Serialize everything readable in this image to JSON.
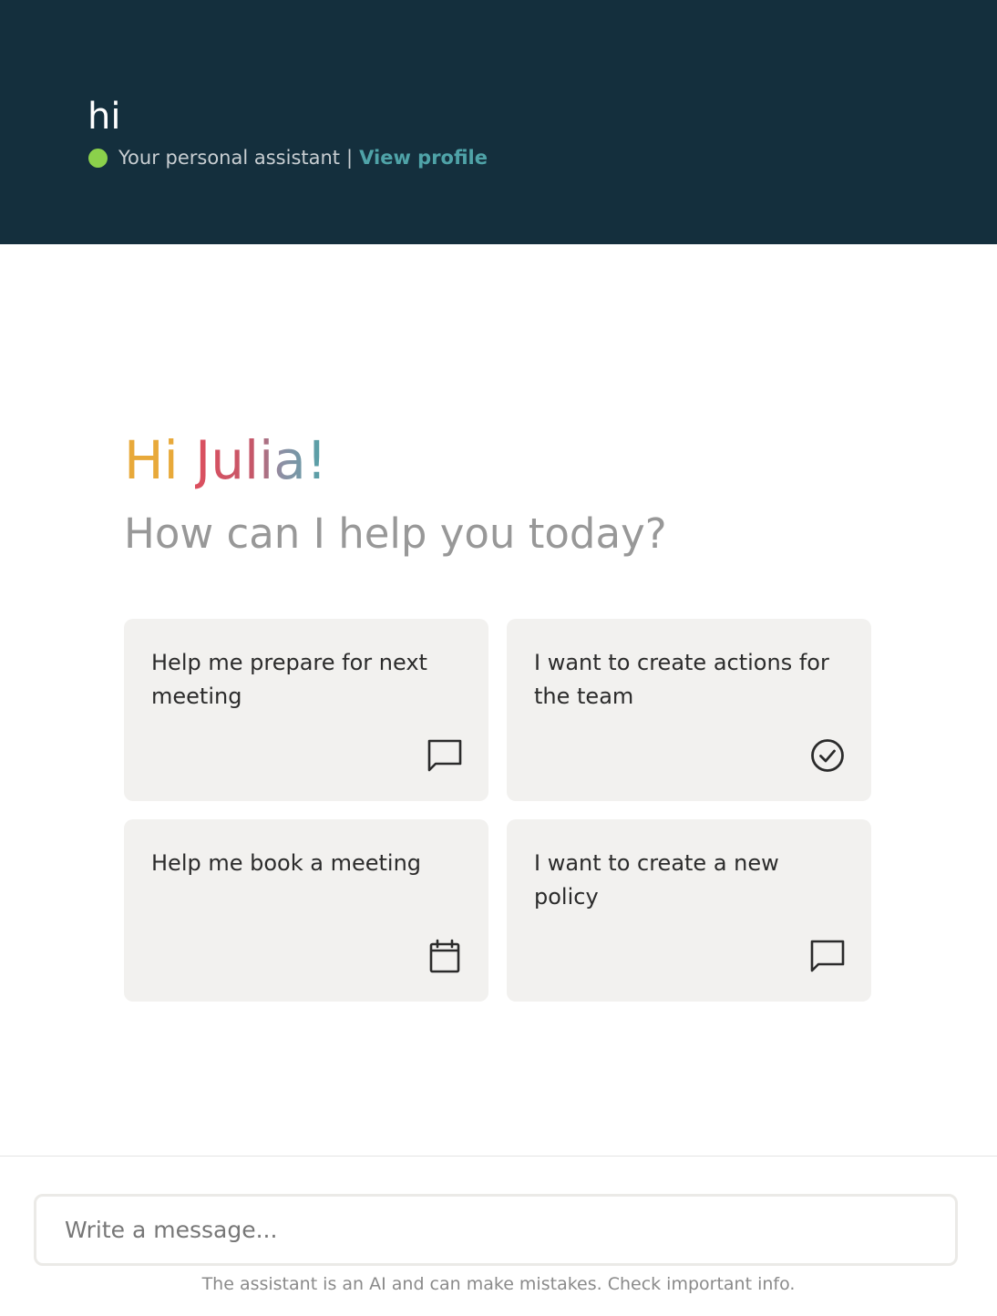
{
  "header": {
    "title": "hi",
    "status_text": "Your personal assistant",
    "separator": "|",
    "profile_link": "View profile",
    "status_color": "#8bd14b"
  },
  "greeting": {
    "hi": "Hi",
    "name": "Julia!",
    "subtitle": "How can I help you today?",
    "gradient_colors": [
      "#e8a93a",
      "#dc4f5e",
      "#c4586a",
      "#4fa3a8"
    ]
  },
  "suggestions": [
    {
      "text": "Help me prepare for next meeting",
      "icon": "chat-bubble-icon"
    },
    {
      "text": "I want to create actions for the team",
      "icon": "check-circle-icon"
    },
    {
      "text": "Help me book a meeting",
      "icon": "calendar-icon"
    },
    {
      "text": "I want to create a new policy",
      "icon": "chat-bubble-icon"
    }
  ],
  "composer": {
    "placeholder": "Write a message...",
    "disclaimer": "The assistant is an AI and can make mistakes. Check important info."
  }
}
